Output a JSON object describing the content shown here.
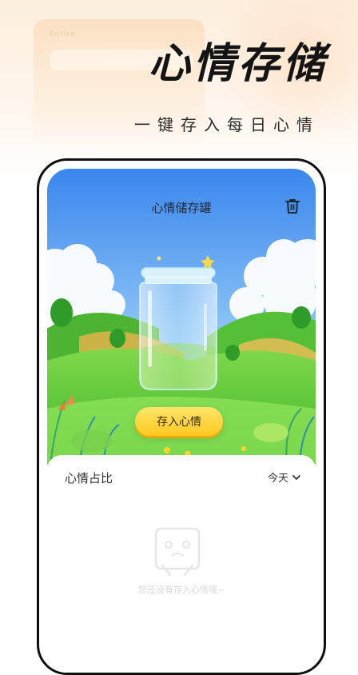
{
  "promo": {
    "headline": "心情存储",
    "subline": "一键存入每日心情",
    "folder_tag": "Entire"
  },
  "app": {
    "title": "心情储存罐",
    "save_button": "存入心情",
    "trash_icon": "trash-icon"
  },
  "panel": {
    "title": "心情占比",
    "period": "今天",
    "period_icon": "chevron-down-icon",
    "empty_text": "您还没有存入心情哦~",
    "empty_icon": "empty-box-face-icon"
  },
  "colors": {
    "sky_top": "#3f8ef0",
    "grass": "#5ccf3a",
    "button": "#ffd331",
    "headline": "#141414"
  }
}
